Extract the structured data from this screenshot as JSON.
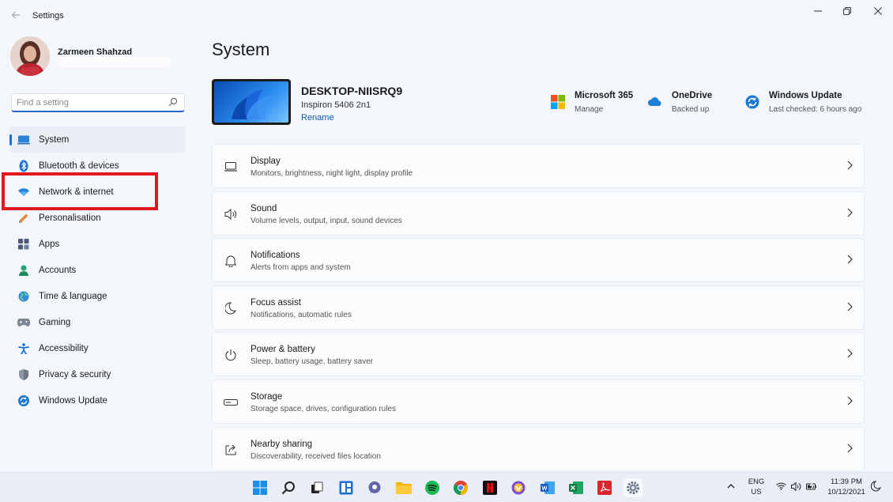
{
  "window": {
    "app_title": "Settings"
  },
  "profile": {
    "name": "Zarmeen Shahzad"
  },
  "search": {
    "placeholder": "Find a setting"
  },
  "sidebar": {
    "items": [
      {
        "label": "System",
        "icon": "laptop-icon",
        "active": true
      },
      {
        "label": "Bluetooth & devices",
        "icon": "bluetooth-icon"
      },
      {
        "label": "Network & internet",
        "icon": "wifi-icon"
      },
      {
        "label": "Personalisation",
        "icon": "pencil-icon"
      },
      {
        "label": "Apps",
        "icon": "apps-icon"
      },
      {
        "label": "Accounts",
        "icon": "person-icon"
      },
      {
        "label": "Time & language",
        "icon": "globe-icon"
      },
      {
        "label": "Gaming",
        "icon": "gamepad-icon"
      },
      {
        "label": "Accessibility",
        "icon": "accessibility-icon"
      },
      {
        "label": "Privacy & security",
        "icon": "shield-icon"
      },
      {
        "label": "Windows Update",
        "icon": "update-icon"
      }
    ]
  },
  "main": {
    "title": "System",
    "device": {
      "name": "DESKTOP-NIISRQ9",
      "model": "Inspiron 5406 2n1",
      "rename": "Rename"
    },
    "quick": [
      {
        "title": "Microsoft 365",
        "sub": "Manage",
        "icon": "microsoft-logo-icon"
      },
      {
        "title": "OneDrive",
        "sub": "Backed up",
        "icon": "cloud-icon"
      },
      {
        "title": "Windows Update",
        "sub": "Last checked: 6 hours ago",
        "icon": "update-icon"
      }
    ],
    "cards": [
      {
        "title": "Display",
        "sub": "Monitors, brightness, night light, display profile",
        "icon": "monitor-icon"
      },
      {
        "title": "Sound",
        "sub": "Volume levels, output, input, sound devices",
        "icon": "speaker-icon"
      },
      {
        "title": "Notifications",
        "sub": "Alerts from apps and system",
        "icon": "bell-icon"
      },
      {
        "title": "Focus assist",
        "sub": "Notifications, automatic rules",
        "icon": "moon-icon"
      },
      {
        "title": "Power & battery",
        "sub": "Sleep, battery usage, battery saver",
        "icon": "power-icon"
      },
      {
        "title": "Storage",
        "sub": "Storage space, drives, configuration rules",
        "icon": "storage-icon"
      },
      {
        "title": "Nearby sharing",
        "sub": "Discoverability, received files location",
        "icon": "share-icon"
      }
    ]
  },
  "taskbar": {
    "lang_line1": "ENG",
    "lang_line2": "US",
    "time": "11:39 PM",
    "date": "10/12/2021"
  },
  "colors": {
    "accent": "#1f6fd0",
    "highlight": "#e1191f",
    "link": "#0f5ca8"
  }
}
